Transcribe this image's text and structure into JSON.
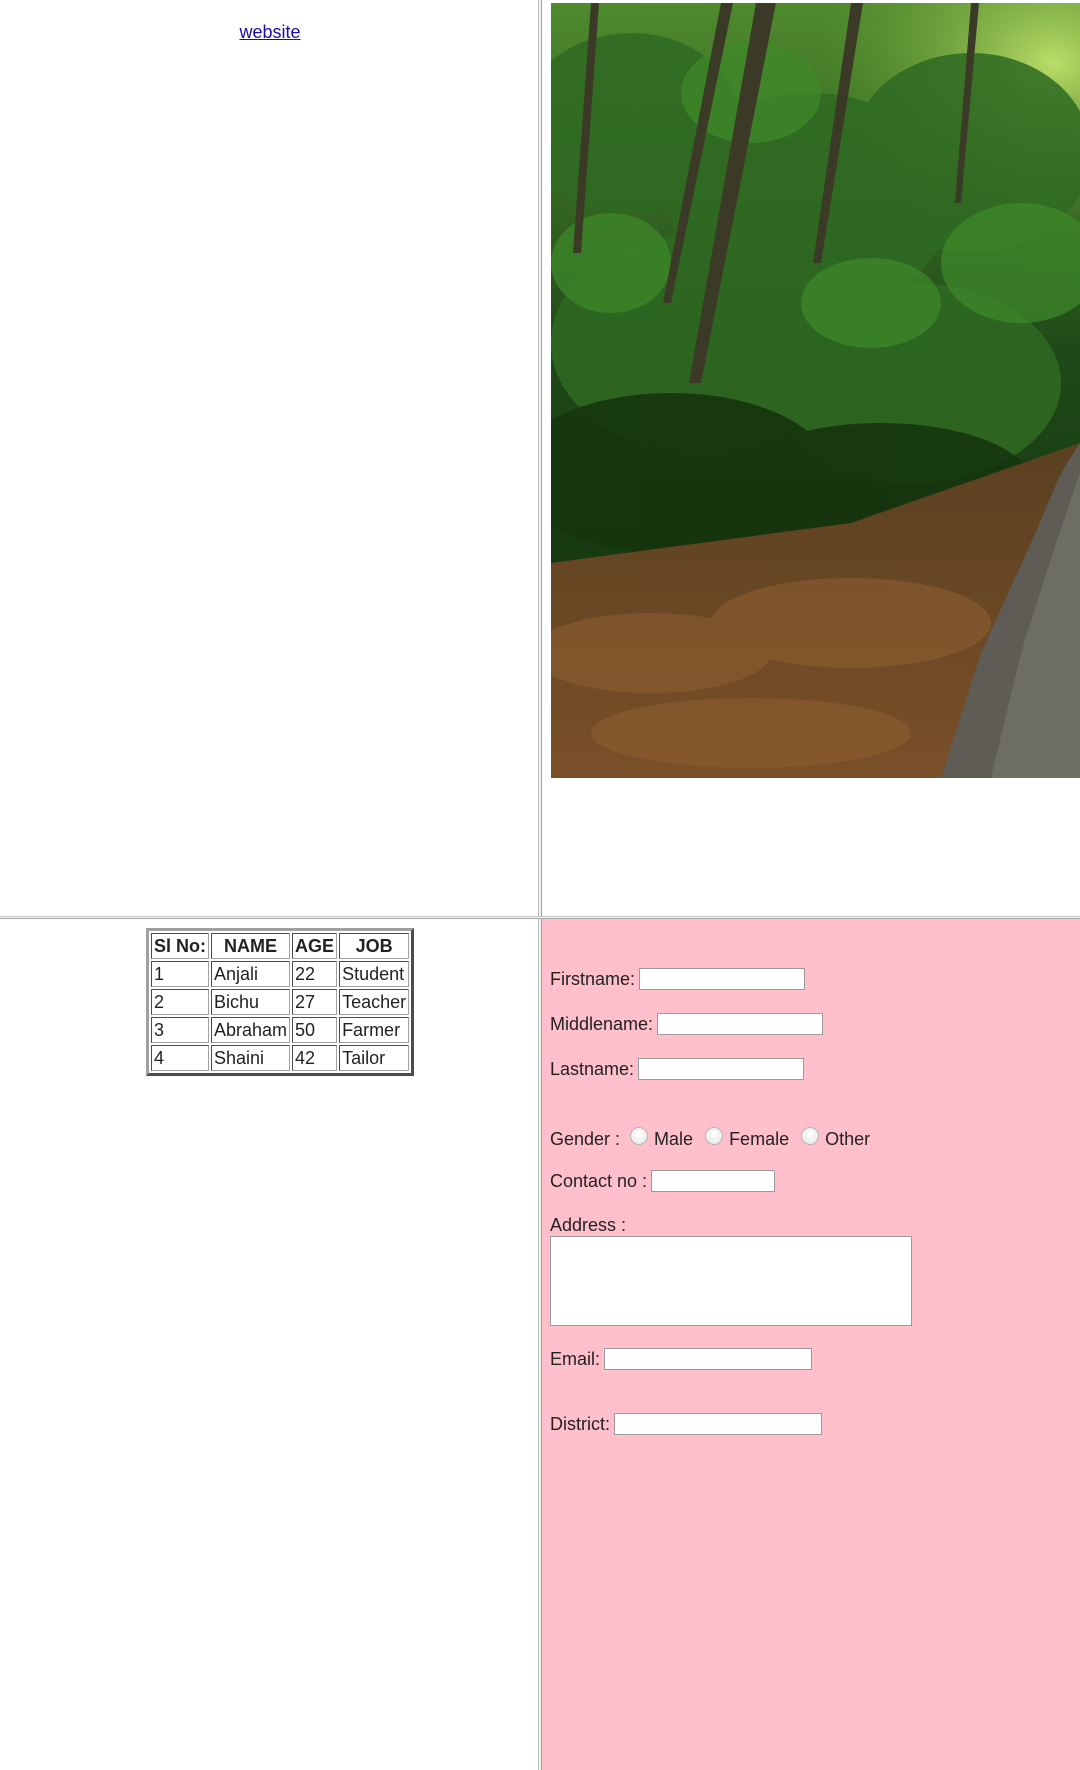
{
  "top_left": {
    "link_text": "website"
  },
  "top_right": {
    "image_alt": "forest path with fallen leaves"
  },
  "table": {
    "headers": [
      "Sl No:",
      "NAME",
      "AGE",
      "JOB"
    ],
    "rows": [
      [
        "1",
        "Anjali",
        "22",
        "Student"
      ],
      [
        "2",
        "Bichu",
        "27",
        "Teacher"
      ],
      [
        "3",
        "Abraham",
        "50",
        "Farmer"
      ],
      [
        "4",
        "Shaini",
        "42",
        "Tailor"
      ]
    ]
  },
  "form": {
    "firstname_label": "Firstname:",
    "middlename_label": "Middlename:",
    "lastname_label": "Lastname:",
    "gender_label": "Gender :",
    "gender_options": [
      "Male",
      "Female",
      "Other"
    ],
    "contact_label": "Contact no :",
    "address_label": "Address :",
    "email_label": "Email:",
    "district_label": "District:",
    "background_color": "#ffc0cb"
  }
}
